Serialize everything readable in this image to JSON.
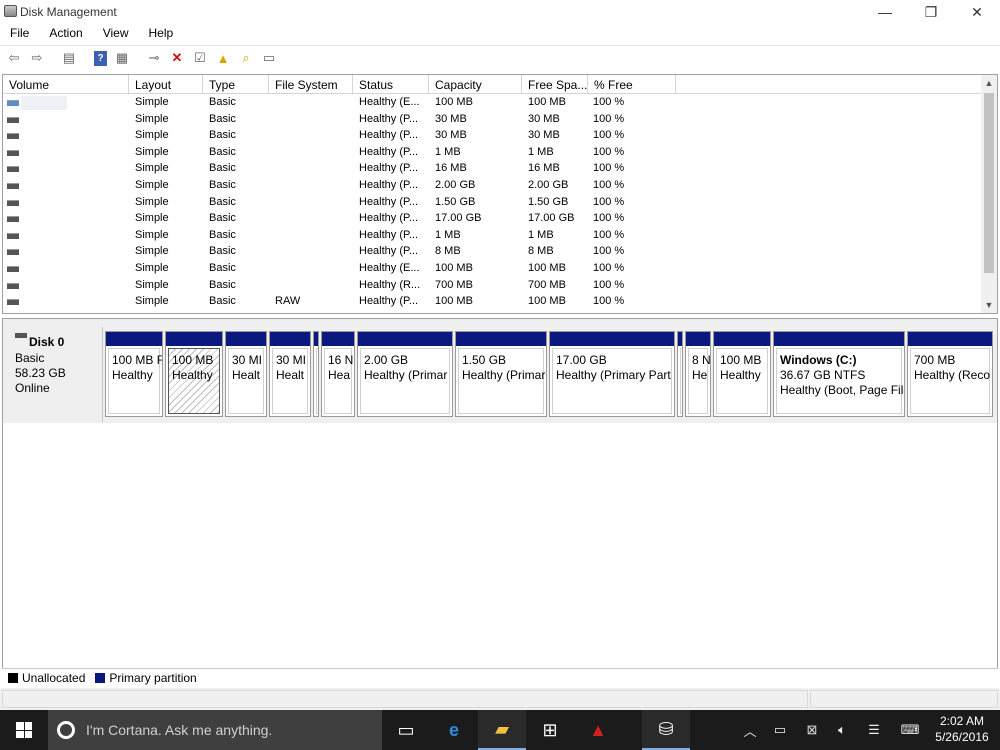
{
  "window": {
    "title": "Disk Management",
    "minimize_glyph": "—",
    "maximize_glyph": "❐",
    "close_glyph": "✕"
  },
  "menu": [
    "File",
    "Action",
    "View",
    "Help"
  ],
  "toolbar_icons": [
    "back-icon",
    "forward-icon",
    "console-view-icon",
    "help-icon",
    "properties-icon",
    "rescan-icon",
    "delete-icon",
    "checklist-icon",
    "up-folder-icon",
    "search-folder-icon",
    "show-list-icon"
  ],
  "volume_list": {
    "columns": [
      "Volume",
      "Layout",
      "Type",
      "File System",
      "Status",
      "Capacity",
      "Free Spa...",
      "% Free"
    ],
    "rows": [
      {
        "layout": "Simple",
        "type": "Basic",
        "fs": "",
        "status": "Healthy (E...",
        "capacity": "100 MB",
        "free": "100 MB",
        "pct": "100 %"
      },
      {
        "layout": "Simple",
        "type": "Basic",
        "fs": "",
        "status": "Healthy (P...",
        "capacity": "30 MB",
        "free": "30 MB",
        "pct": "100 %"
      },
      {
        "layout": "Simple",
        "type": "Basic",
        "fs": "",
        "status": "Healthy (P...",
        "capacity": "30 MB",
        "free": "30 MB",
        "pct": "100 %"
      },
      {
        "layout": "Simple",
        "type": "Basic",
        "fs": "",
        "status": "Healthy (P...",
        "capacity": "1 MB",
        "free": "1 MB",
        "pct": "100 %"
      },
      {
        "layout": "Simple",
        "type": "Basic",
        "fs": "",
        "status": "Healthy (P...",
        "capacity": "16 MB",
        "free": "16 MB",
        "pct": "100 %"
      },
      {
        "layout": "Simple",
        "type": "Basic",
        "fs": "",
        "status": "Healthy (P...",
        "capacity": "2.00 GB",
        "free": "2.00 GB",
        "pct": "100 %"
      },
      {
        "layout": "Simple",
        "type": "Basic",
        "fs": "",
        "status": "Healthy (P...",
        "capacity": "1.50 GB",
        "free": "1.50 GB",
        "pct": "100 %"
      },
      {
        "layout": "Simple",
        "type": "Basic",
        "fs": "",
        "status": "Healthy (P...",
        "capacity": "17.00 GB",
        "free": "17.00 GB",
        "pct": "100 %"
      },
      {
        "layout": "Simple",
        "type": "Basic",
        "fs": "",
        "status": "Healthy (P...",
        "capacity": "1 MB",
        "free": "1 MB",
        "pct": "100 %"
      },
      {
        "layout": "Simple",
        "type": "Basic",
        "fs": "",
        "status": "Healthy (P...",
        "capacity": "8 MB",
        "free": "8 MB",
        "pct": "100 %"
      },
      {
        "layout": "Simple",
        "type": "Basic",
        "fs": "",
        "status": "Healthy (E...",
        "capacity": "100 MB",
        "free": "100 MB",
        "pct": "100 %"
      },
      {
        "layout": "Simple",
        "type": "Basic",
        "fs": "",
        "status": "Healthy (R...",
        "capacity": "700 MB",
        "free": "700 MB",
        "pct": "100 %"
      },
      {
        "layout": "Simple",
        "type": "Basic",
        "fs": "RAW",
        "status": "Healthy (P...",
        "capacity": "100 MB",
        "free": "100 MB",
        "pct": "100 %"
      }
    ]
  },
  "disk0": {
    "name": "Disk 0",
    "type": "Basic",
    "size": "58.23 GB",
    "state": "Online",
    "partitions": [
      {
        "lines": [
          "100 MB F",
          "Healthy"
        ],
        "bold": false,
        "selected": false
      },
      {
        "lines": [
          "100 MB",
          "Healthy"
        ],
        "bold": false,
        "selected": true
      },
      {
        "lines": [
          "30 MI",
          "Healt"
        ],
        "bold": false,
        "selected": false
      },
      {
        "lines": [
          "30 MI",
          "Healt"
        ],
        "bold": false,
        "selected": false
      },
      {
        "lines": [
          "",
          ""
        ],
        "bold": false,
        "selected": false
      },
      {
        "lines": [
          "16 N",
          "Hea"
        ],
        "bold": false,
        "selected": false
      },
      {
        "lines": [
          "2.00 GB",
          "Healthy (Primar"
        ],
        "bold": false,
        "selected": false
      },
      {
        "lines": [
          "1.50 GB",
          "Healthy (Primar"
        ],
        "bold": false,
        "selected": false
      },
      {
        "lines": [
          "17.00 GB",
          "Healthy (Primary Part"
        ],
        "bold": false,
        "selected": false
      },
      {
        "lines": [
          "",
          ""
        ],
        "bold": false,
        "selected": false
      },
      {
        "lines": [
          "8 N",
          "He"
        ],
        "bold": false,
        "selected": false
      },
      {
        "lines": [
          "100 MB",
          "Healthy"
        ],
        "bold": false,
        "selected": false
      },
      {
        "lines": [
          "Windows  (C:)",
          "36.67 GB NTFS",
          "Healthy (Boot, Page File"
        ],
        "bold": true,
        "selected": false
      },
      {
        "lines": [
          "700 MB",
          "Healthy (Reco"
        ],
        "bold": false,
        "selected": false
      }
    ]
  },
  "legend": [
    {
      "label": "Unallocated",
      "color": "#000000"
    },
    {
      "label": "Primary partition",
      "color": "#0a1880"
    }
  ],
  "taskbar": {
    "search_placeholder": "I'm Cortana. Ask me anything.",
    "apps": [
      "task-view-icon",
      "edge-icon",
      "file-explorer-icon",
      "store-icon",
      "red-app-icon",
      "disk-management-icon"
    ],
    "tray": [
      "chevron-up-icon",
      "battery-icon",
      "network-icon",
      "volume-icon",
      "action-center-icon",
      "keyboard-icon"
    ],
    "time": "2:02 AM",
    "date": "5/26/2016"
  },
  "colors": {
    "partition_header": "#0a1880",
    "taskbar_bg": "#1b1b1b"
  }
}
